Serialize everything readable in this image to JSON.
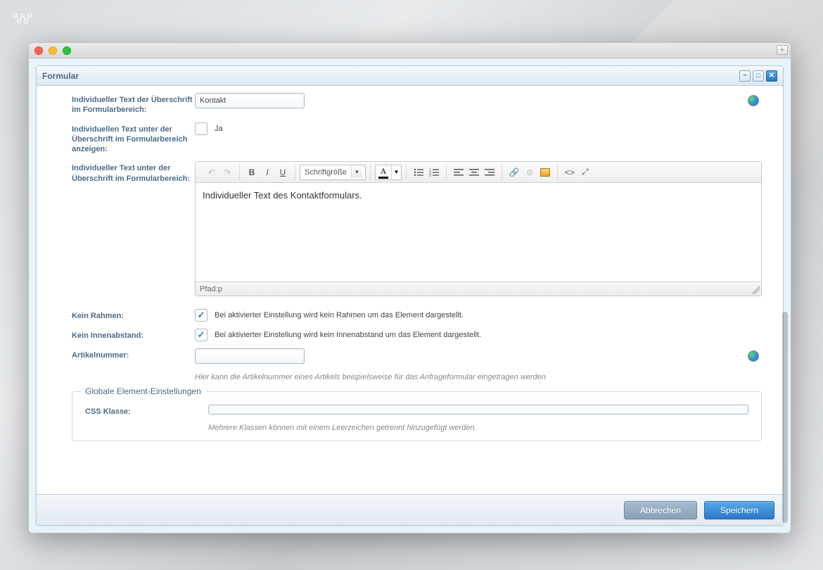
{
  "app_logo": "ooco",
  "window": {
    "add_tab": "+"
  },
  "panel": {
    "title": "Formular",
    "min_icon": "−",
    "max_icon": "□",
    "close_icon": "✕"
  },
  "form": {
    "heading_label": "Individueller Text der Überschrift im Formularbereich:",
    "heading_value": "Kontakt",
    "show_subtext_label": "Individuellen Text unter der Überschrift im Formularbereich anzeigen:",
    "show_subtext_value": "Ja",
    "subtext_label": "Individueller Text unter der Überschrift im Formularbereich:",
    "subtext_content": "Individueller Text des Kontaktformulars.",
    "no_border_label": "Kein Rahmen:",
    "no_border_hint": "Bei aktivierter Einstellung wird kein Rahmen um das Element dargestellt.",
    "no_padding_label": "Kein Innenabstand:",
    "no_padding_hint": "Bei aktivierter Einstellung wird kein Innenabstand um das Element dargestellt.",
    "article_no_label": "Artikelnummer:",
    "article_no_value": "",
    "article_no_hint": "Hier kann die Artikelnummer eines Artikels beispielsweise für das Anfrageformular eingetragen werden"
  },
  "editor": {
    "font_size_label": "Schriftgröße",
    "path_prefix": "Pfad: ",
    "path_value": "p"
  },
  "global": {
    "legend": "Globale Element-Einstellungen",
    "css_class_label": "CSS Klasse:",
    "css_class_value": "",
    "css_class_hint": "Mehrere Klassen können mit einem Leerzeichen getrennt hinzugefügt werden."
  },
  "buttons": {
    "cancel": "Abbrechen",
    "save": "Speichern"
  }
}
